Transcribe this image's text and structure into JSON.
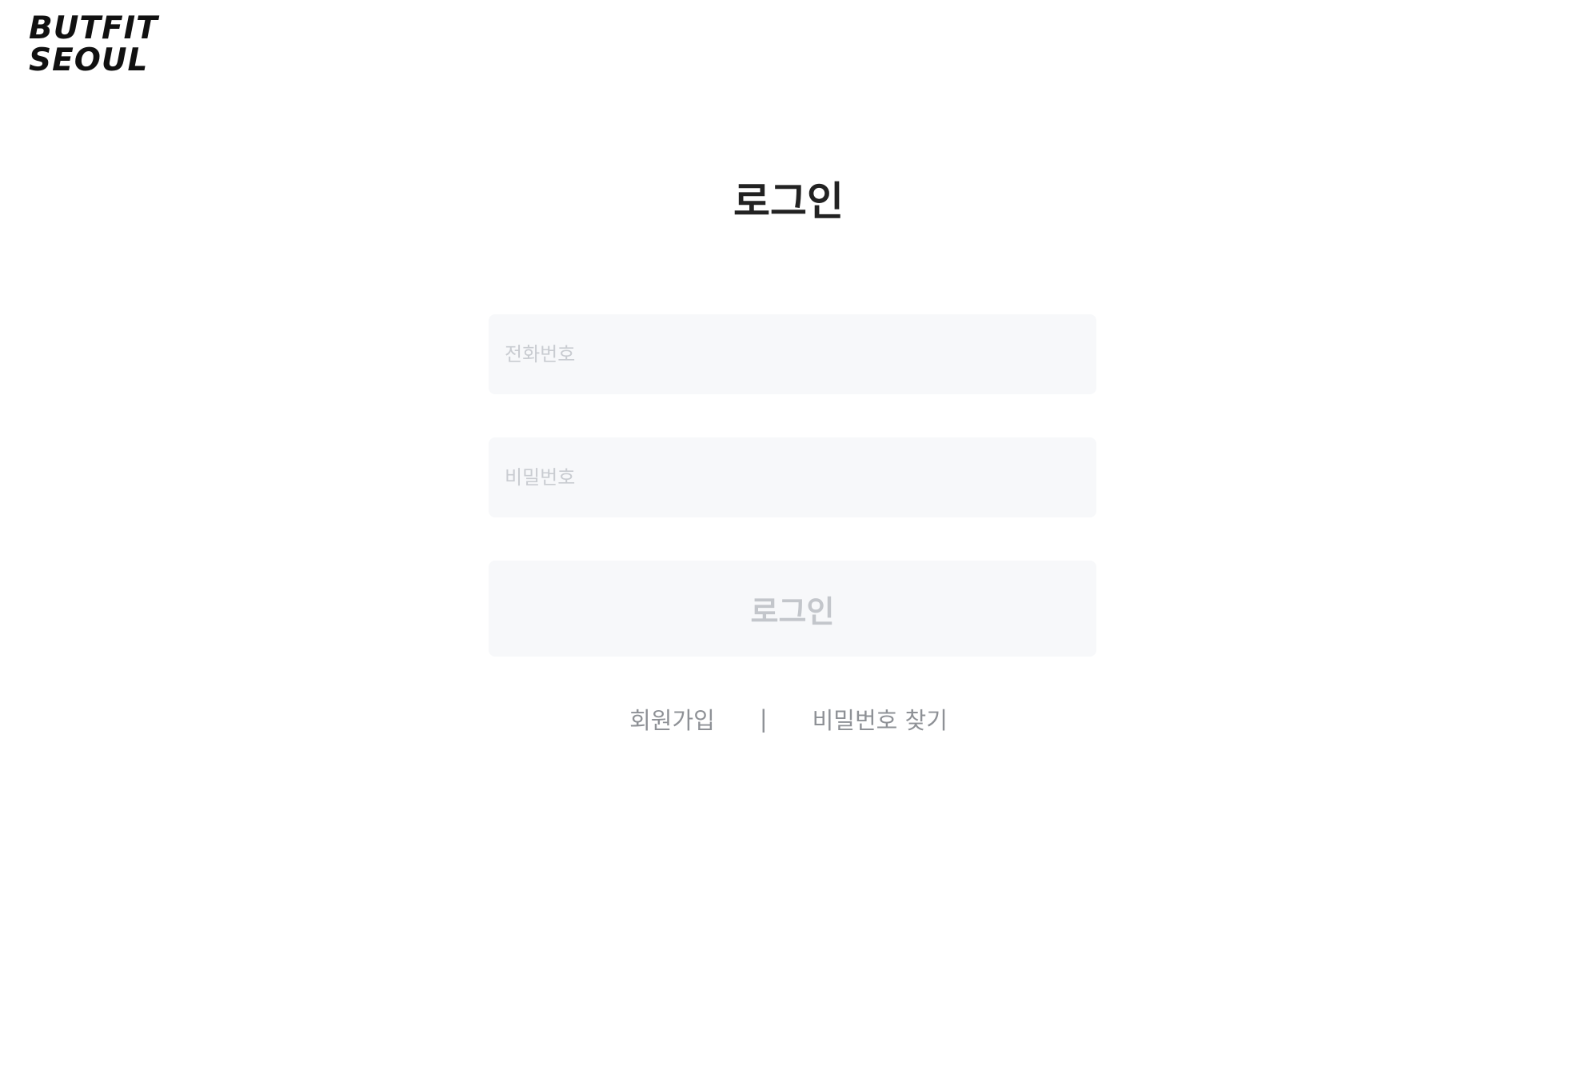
{
  "brand": {
    "line1": "BUTFIT",
    "line2": "SEOUL"
  },
  "page_title": "로그인",
  "form": {
    "phone_placeholder": "전화번호",
    "password_placeholder": "비밀번호",
    "login_label": "로그인"
  },
  "links": {
    "signup": "회원가입",
    "divider": "|",
    "find_password": "비밀번호 찾기"
  },
  "colors": {
    "title": "#222222",
    "field_background": "#f7f8fa",
    "placeholder": "#c9ccd1",
    "login_text": "#c3c6cb",
    "link_text": "#8e9196"
  }
}
